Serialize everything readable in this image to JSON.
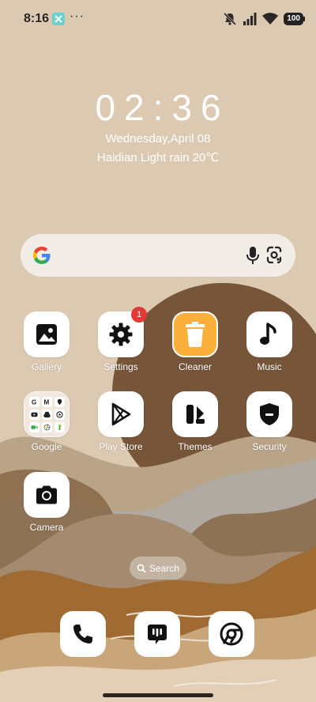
{
  "status_bar": {
    "time": "8:16",
    "more": "···",
    "battery": "100",
    "icons": [
      "app-notification-icon",
      "mute-icon",
      "signal-icon",
      "wifi-icon",
      "battery-icon"
    ]
  },
  "clock": {
    "time": "02:36",
    "date": "Wednesday,April 08",
    "weather": "Haidian Light rain 20℃"
  },
  "search_bar": {
    "icons": [
      "google-logo-icon",
      "microphone-icon",
      "google-lens-icon"
    ]
  },
  "apps": [
    {
      "label": "Gallery",
      "icon": "gallery-icon"
    },
    {
      "label": "Settings",
      "icon": "gear-icon",
      "badge": "1"
    },
    {
      "label": "Cleaner",
      "icon": "trash-icon"
    },
    {
      "label": "Music",
      "icon": "music-note-icon"
    },
    {
      "label": "Google",
      "icon": "folder-icon"
    },
    {
      "label": "Play Store",
      "icon": "play-store-icon"
    },
    {
      "label": "Themes",
      "icon": "themes-icon"
    },
    {
      "label": "Security",
      "icon": "shield-icon"
    },
    {
      "label": "Camera",
      "icon": "camera-icon"
    }
  ],
  "home_search": {
    "label": "Search"
  },
  "dock": [
    {
      "icon": "phone-icon"
    },
    {
      "icon": "messages-icon"
    },
    {
      "icon": "chrome-icon"
    }
  ],
  "colors": {
    "wallpaper_base": "#dcc9b1",
    "badge": "#e53935",
    "cleaner": "#fbb03b"
  }
}
